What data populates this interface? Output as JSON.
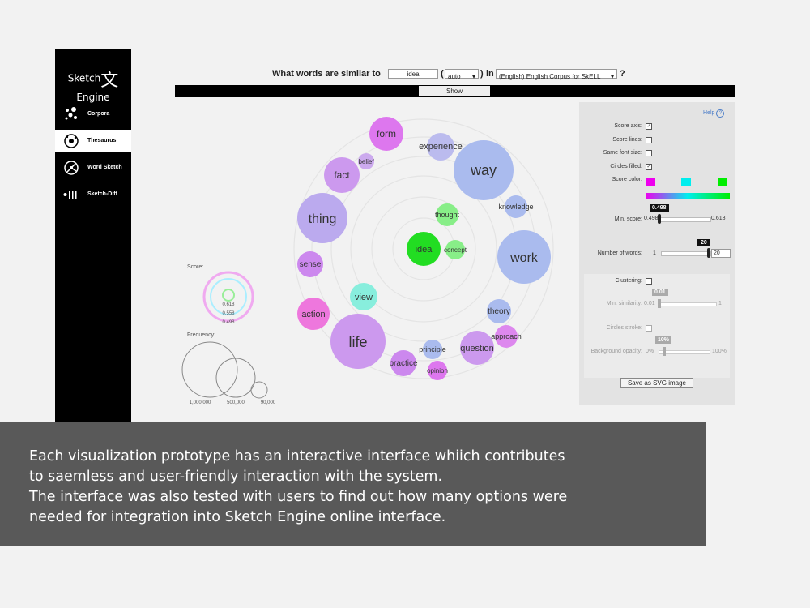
{
  "sidebar": {
    "logo_left": "Sketch",
    "logo_glyph": "文",
    "logo_right": "Engine",
    "items": [
      {
        "label": "Corpora",
        "icon": "corpora-icon"
      },
      {
        "label": "Thesaurus",
        "icon": "thesaurus-icon",
        "active": true
      },
      {
        "label": "Word Sketch",
        "icon": "word-sketch-icon"
      },
      {
        "label": "Sketch-Diff",
        "icon": "sketch-diff-icon"
      }
    ]
  },
  "query": {
    "prefix": "What words are similar to",
    "word": "idea",
    "pos": "auto",
    "in_label": "in",
    "corpus": "(English) English Corpus for SkELL",
    "suffix": "?",
    "show": "Show"
  },
  "legend": {
    "score_label": "Score:",
    "score_values": [
      "0.618",
      "0.558",
      "0.498"
    ],
    "frequency_label": "Frequency:",
    "frequency_values": [
      "1,000,000",
      "500,000",
      "90,000"
    ]
  },
  "words": [
    {
      "text": "idea",
      "color": "#22dd22"
    },
    {
      "text": "thought",
      "color": "#88ee88"
    },
    {
      "text": "concept",
      "color": "#88ee88"
    },
    {
      "text": "view",
      "color": "#88eedd"
    },
    {
      "text": "form",
      "color": "#dd77ee"
    },
    {
      "text": "experience",
      "color": "#bbbbee"
    },
    {
      "text": "way",
      "color": "#aabbee"
    },
    {
      "text": "belief",
      "color": "#ccaaee"
    },
    {
      "text": "fact",
      "color": "#cc99ee"
    },
    {
      "text": "knowledge",
      "color": "#aabbee"
    },
    {
      "text": "thing",
      "color": "#bbaaee"
    },
    {
      "text": "work",
      "color": "#aabbee"
    },
    {
      "text": "sense",
      "color": "#cc88ee"
    },
    {
      "text": "action",
      "color": "#ee77dd"
    },
    {
      "text": "theory",
      "color": "#aabbee"
    },
    {
      "text": "approach",
      "color": "#dd88ee"
    },
    {
      "text": "life",
      "color": "#cc99ee"
    },
    {
      "text": "question",
      "color": "#cc99ee"
    },
    {
      "text": "principle",
      "color": "#aabbee"
    },
    {
      "text": "practice",
      "color": "#cc88ee"
    },
    {
      "text": "opinion",
      "color": "#dd77ee"
    }
  ],
  "panel": {
    "help": "Help",
    "score_axis": "Score axis:",
    "score_lines": "Score lines:",
    "same_font_size": "Same font size:",
    "circles_filled": "Circles filled:",
    "score_color": "Score color:",
    "score_colors": [
      "#ee00ee",
      "#00eeee",
      "#00ee00"
    ],
    "min_score_label": "Min. score:",
    "min_score_value": "0.498",
    "min_score_left": "0.498",
    "min_score_right": "0.618",
    "min_score_level": 0.0,
    "num_words_label": "Number of words:",
    "num_words_value": "20",
    "num_words_left": "1",
    "num_words_right": "20",
    "num_words_level": 1.0,
    "clustering": "Clustering:",
    "min_similarity": "Min. similarity:",
    "min_similarity_value": "0.01",
    "min_similarity_left": "0.01",
    "min_similarity_right": "1",
    "circles_stroke": "Circles stroke:",
    "bg_opacity": "Background opacity:",
    "bg_opacity_value": "10%",
    "bg_opacity_left": "0%",
    "bg_opacity_right": "100%",
    "save": "Save as SVG image"
  },
  "caption": {
    "line1": "Each visualization prototype has an interactive interface whiich contributes",
    "line2": "to saemless and user-friendly interaction with the system.",
    "line3": "The interface was also tested with users to find out how many options were",
    "line4": "needed for integration into Sketch Engine online interface."
  }
}
